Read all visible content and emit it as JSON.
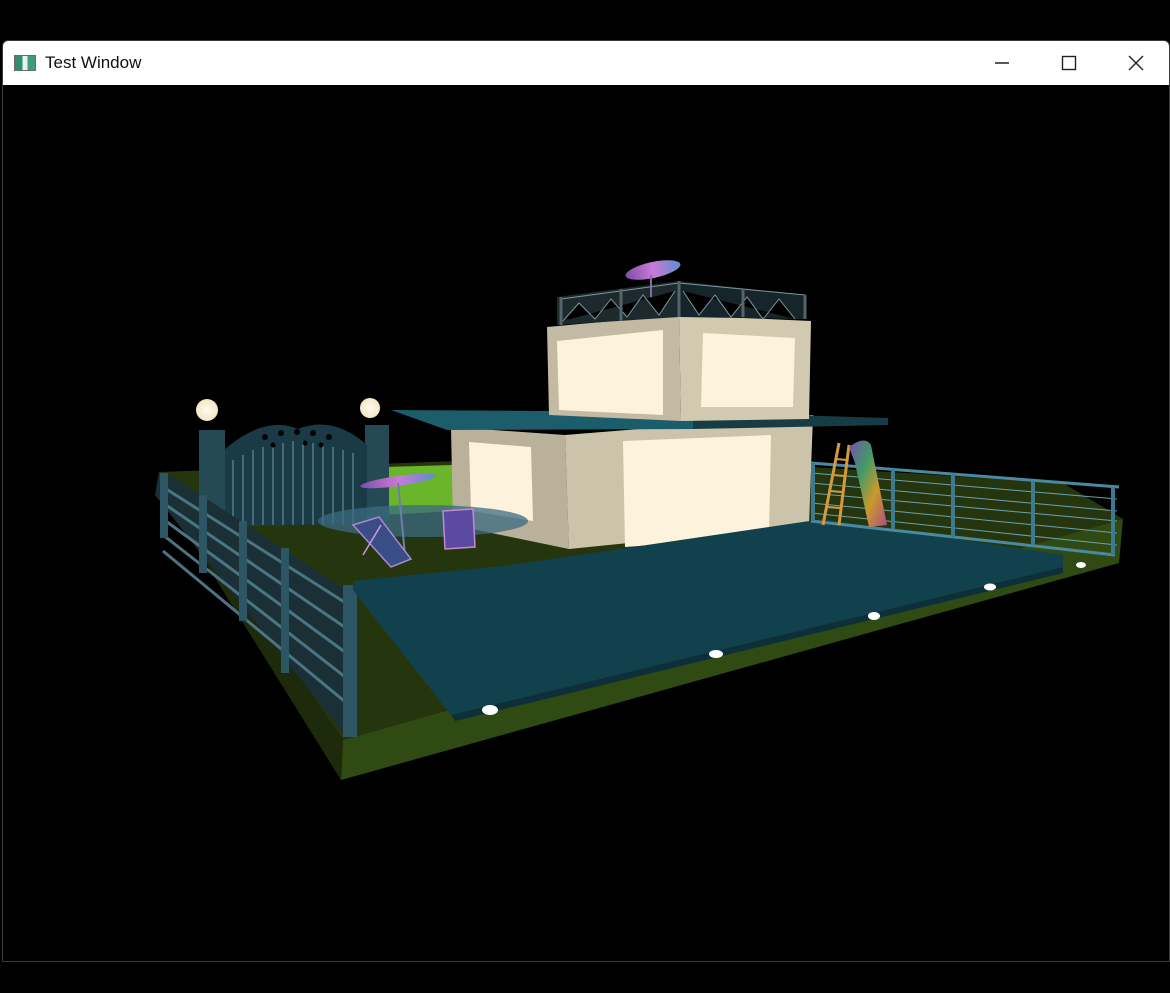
{
  "window": {
    "title": "Test Window",
    "icons": {
      "app": "app-icon",
      "minimize": "minimize-icon",
      "maximize": "maximize-icon",
      "close": "close-icon"
    }
  },
  "scene": {
    "background_color": "#000000",
    "lawn_color": "#25360f",
    "pool_color": "#12414e",
    "wall_color": "#c8c0a8",
    "window_glow_color": "#fdf3dc",
    "fence_color": "#2e5864",
    "lamp_color": "#fff4d6"
  }
}
